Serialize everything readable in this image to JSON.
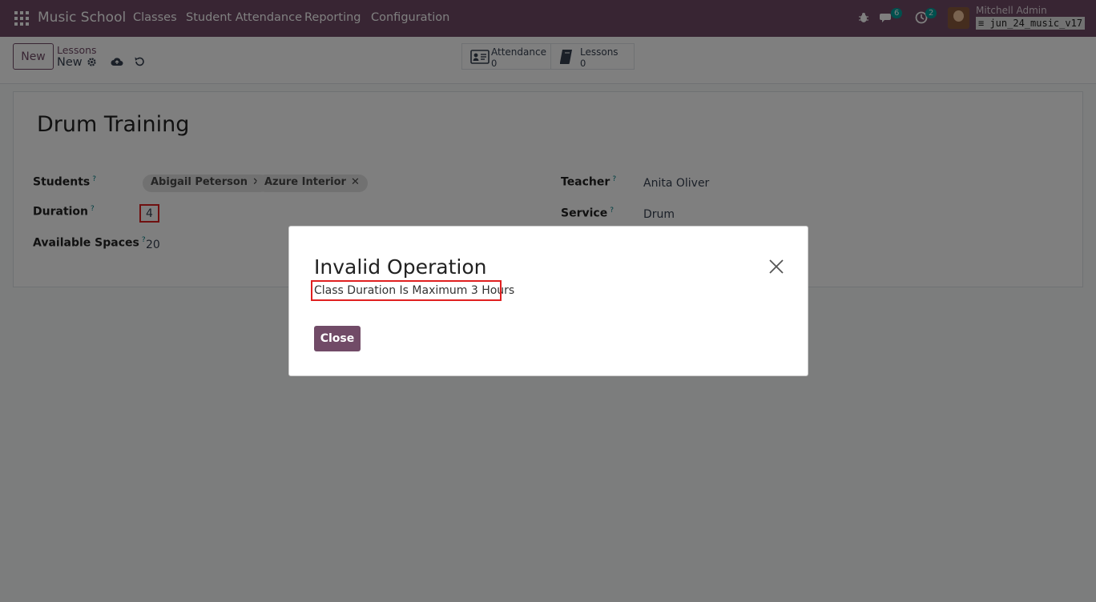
{
  "navbar": {
    "brand": "Music School",
    "menu": [
      "Classes",
      "Student Attendance",
      "Reporting",
      "Configuration"
    ],
    "messages_count": "6",
    "activities_count": "2",
    "user_name": "Mitchell Admin",
    "db_name": "jun_24_music_v17"
  },
  "control": {
    "new_label": "New",
    "breadcrumb_parent": "Lessons",
    "breadcrumb_current": "New",
    "smart_buttons": [
      {
        "label": "Attendance",
        "count": "0"
      },
      {
        "label": "Lessons",
        "count": "0"
      }
    ]
  },
  "form": {
    "title": "Drum Training",
    "students_label": "Students",
    "students": [
      "Abigail Peterson",
      "Azure Interior"
    ],
    "duration_label": "Duration",
    "duration_value": "4",
    "spaces_label": "Available Spaces",
    "spaces_value": "20",
    "teacher_label": "Teacher",
    "teacher_value": "Anita Oliver",
    "service_label": "Service",
    "service_value": "Drum",
    "help_mark": "?"
  },
  "dialog": {
    "title": "Invalid Operation",
    "message": "Class Duration Is Maximum 3 Hours",
    "close_label": "Close"
  },
  "colors": {
    "brand": "#714b67",
    "highlight": "#e02020"
  }
}
